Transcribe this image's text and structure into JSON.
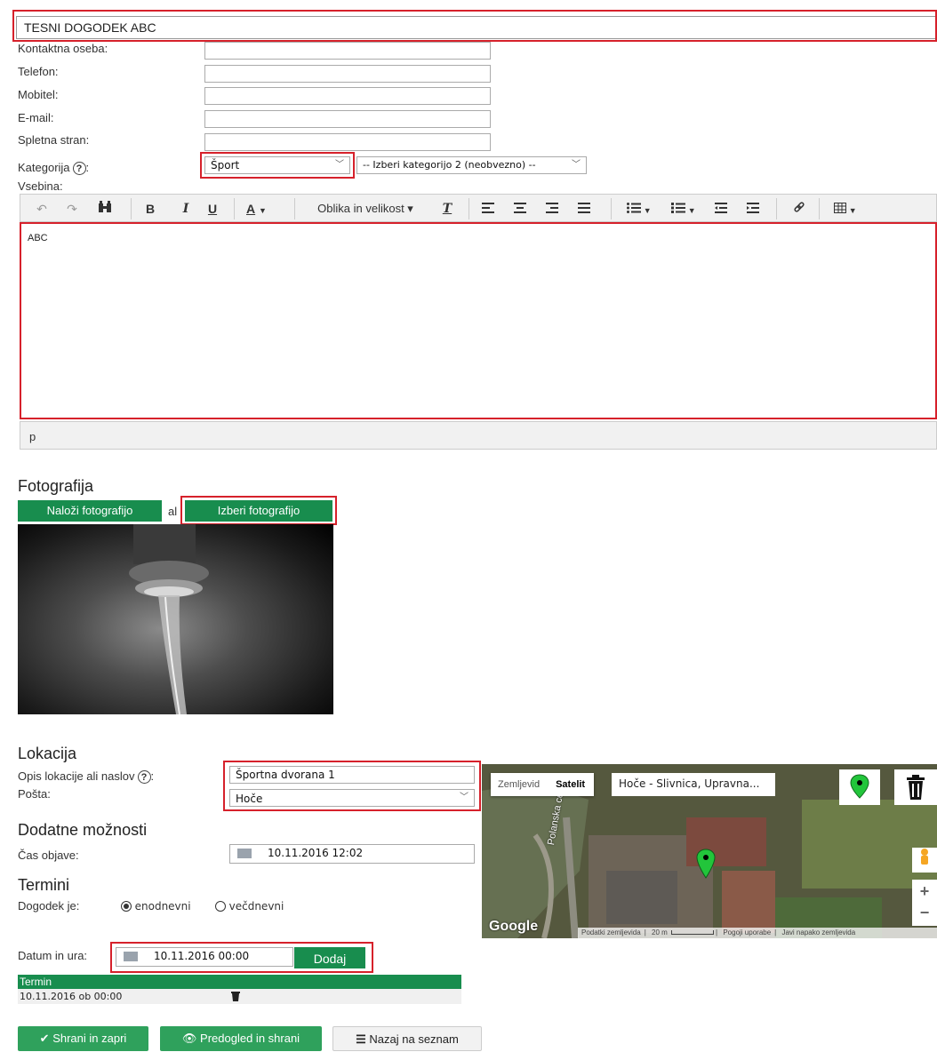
{
  "event_title": "TESNI DOGODEK ABC",
  "contact": {
    "labels": {
      "person": "Kontaktna oseba:",
      "phone": "Telefon:",
      "mobile": "Mobitel:",
      "email": "E-mail:",
      "website": "Spletna stran:"
    },
    "values": {
      "person": "",
      "phone": "",
      "mobile": "",
      "email": "",
      "website": ""
    }
  },
  "category": {
    "label": "Kategorija",
    "help": "?",
    "colon": ":",
    "selected": "Šport",
    "second_selected": "-- Izberi kategorijo 2 (neobvezno) --"
  },
  "content": {
    "label": "Vsebina:",
    "body_text": "ABC",
    "status_path": "p",
    "toolbar": {
      "undo": "↶",
      "redo": "↷",
      "find": "🔍",
      "bold": "B",
      "italic": "I",
      "underline": "U",
      "font_color": "A",
      "format_dropdown": "Oblika in velikost ▾",
      "clear_format": "Tx"
    }
  },
  "photo": {
    "heading": "Fotografija",
    "upload_button": "Naloži fotografijo",
    "or_text": "al",
    "choose_button": "Izberi fotografijo"
  },
  "location": {
    "heading": "Lokacija",
    "desc_label": "Opis lokacije ali naslov",
    "desc_value": "Športna dvorana 1",
    "post_label": "Pošta:",
    "post_value": "Hoče"
  },
  "map": {
    "type_map": "Zemljevid",
    "type_satellite": "Satelit",
    "search_value": "Hoče - Slivnica, Upravna...",
    "road_label": "Polanska cesta",
    "google_logo": "Google",
    "footer": {
      "map_data": "Podatki zemljevida",
      "scale": "20 m",
      "terms": "Pogoji uporabe",
      "report": "Javi napako zemljevida"
    },
    "zoom_in": "+",
    "zoom_out": "−"
  },
  "extra": {
    "heading": "Dodatne možnosti",
    "publish_label": "Čas objave:",
    "publish_value": "10.11.2016 12:02"
  },
  "terms": {
    "heading": "Termini",
    "event_label": "Dogodek je:",
    "option_single": "enodnevni",
    "option_multi": "večdnevni",
    "selected": "enodnevni",
    "date_label": "Datum in ura:",
    "date_value": "10.11.2016 00:00",
    "add_button": "Dodaj",
    "table_header": "Termin",
    "rows": [
      {
        "value": "10.11.2016 ob 00:00"
      }
    ]
  },
  "actions": {
    "save_close": "Shrani in zapri",
    "preview_save": "Predogled in shrani",
    "back_list": "Nazaj na seznam"
  },
  "colors": {
    "accent_green": "#188d4e",
    "highlight_red": "#d6212b"
  }
}
